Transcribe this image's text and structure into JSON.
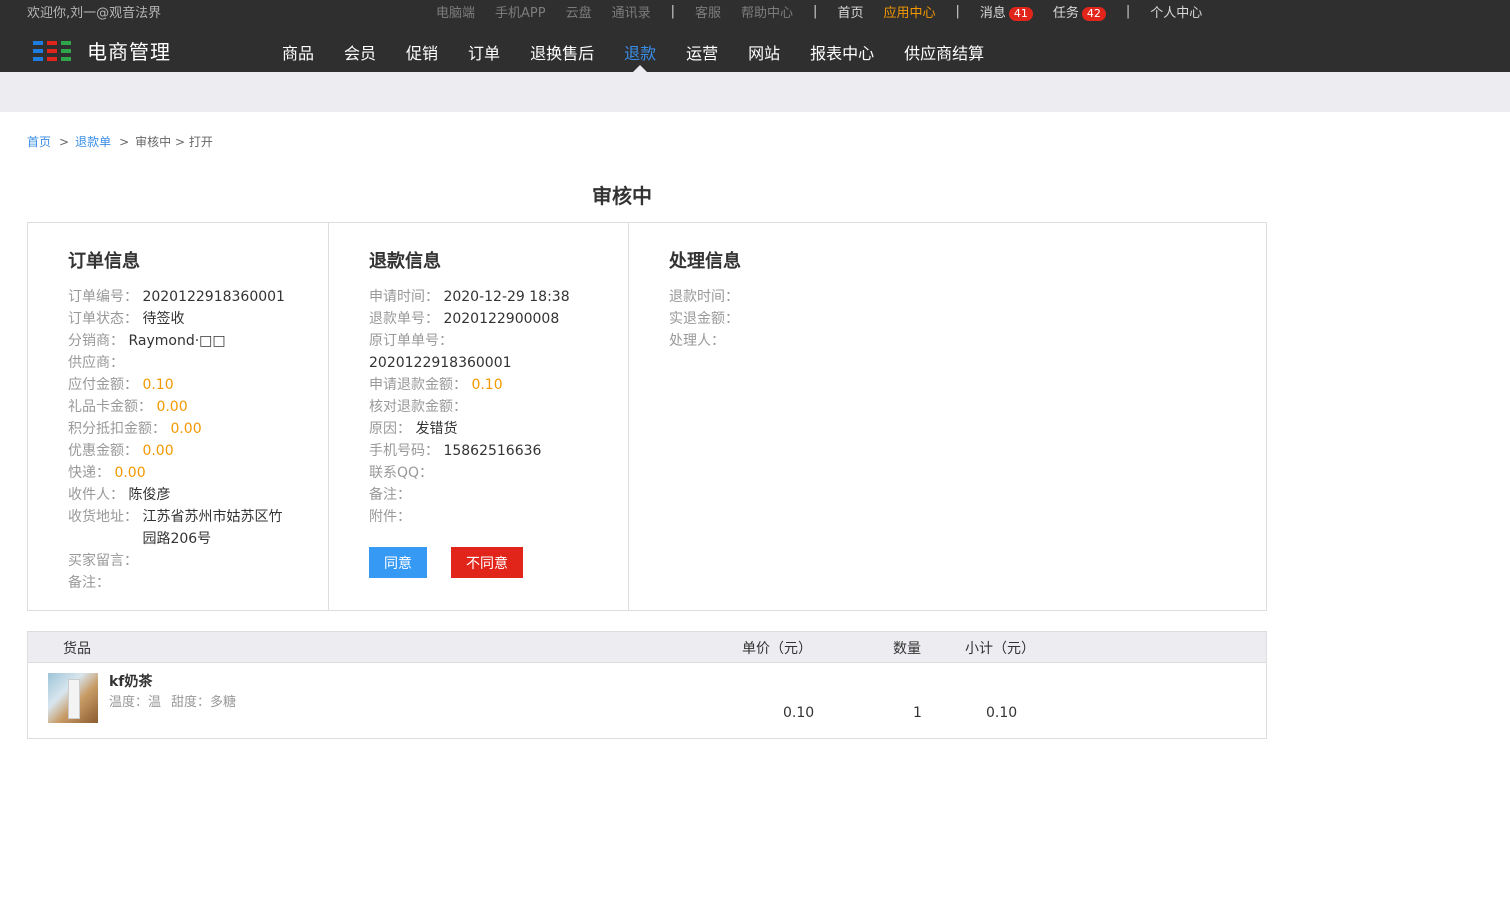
{
  "top": {
    "welcome": "欢迎你,刘一@观音法界",
    "links": [
      "电脑端",
      "手机APP",
      "云盘",
      "通讯录"
    ],
    "links2": [
      "客服",
      "帮助中心"
    ],
    "home": "首页",
    "app_center": "应用中心",
    "messages": "消息",
    "messages_count": "41",
    "tasks": "任务",
    "tasks_count": "42",
    "personal": "个人中心",
    "separator": "|"
  },
  "logo": {
    "text": "电商管理",
    "colors": [
      "#1f7de0",
      "#e1251b",
      "#2fa64a"
    ]
  },
  "nav": [
    "商品",
    "会员",
    "促销",
    "订单",
    "退换售后",
    "退款",
    "运营",
    "网站",
    "报表中心",
    "供应商结算"
  ],
  "nav_active": "退款",
  "breadcrumb": {
    "home": "首页",
    "refund_list": "退款单",
    "rest": "审核中 > 打开",
    "gt": ">"
  },
  "status_title": "审核中",
  "order_info": {
    "title": "订单信息",
    "order_no": {
      "label": "订单编号：",
      "value": "2020122918360001"
    },
    "order_status": {
      "label": "订单状态：",
      "value": "待签收"
    },
    "distributor": {
      "label": "分销商：",
      "value": "Raymond·□□"
    },
    "supplier": {
      "label": "供应商：",
      "value": ""
    },
    "payable": {
      "label": "应付金额：",
      "value": "0.10"
    },
    "gift_card": {
      "label": "礼品卡金额：",
      "value": "0.00"
    },
    "points": {
      "label": "积分抵扣金额：",
      "value": "0.00"
    },
    "discount": {
      "label": "优惠金额：",
      "value": "0.00"
    },
    "shipping": {
      "label": "快递：",
      "value": "0.00"
    },
    "receiver": {
      "label": "收件人：",
      "value": "陈俊彦"
    },
    "address": {
      "label": "收货地址：",
      "value": "江苏省苏州市姑苏区竹园路206号"
    },
    "buyer_msg": {
      "label": "买家留言：",
      "value": ""
    },
    "remark": {
      "label": "备注：",
      "value": ""
    }
  },
  "refund_info": {
    "title": "退款信息",
    "apply_time": {
      "label": "申请时间：",
      "value": "2020-12-29 18:38"
    },
    "refund_no": {
      "label": "退款单号：",
      "value": "2020122900008"
    },
    "orig_order_no": {
      "label": "原订单单号：",
      "value": "2020122918360001"
    },
    "apply_amount": {
      "label": "申请退款金额：",
      "value": "0.10"
    },
    "check_amount": {
      "label": "核对退款金额：",
      "value": ""
    },
    "reason": {
      "label": "原因：",
      "value": "发错货"
    },
    "phone": {
      "label": "手机号码：",
      "value": "15862516636"
    },
    "qq": {
      "label": "联系QQ：",
      "value": ""
    },
    "remark": {
      "label": "备注：",
      "value": ""
    },
    "attachment": {
      "label": "附件：",
      "value": ""
    },
    "agree_label": "同意",
    "disagree_label": "不同意"
  },
  "process_info": {
    "title": "处理信息",
    "refund_time": {
      "label": "退款时间：",
      "value": ""
    },
    "actual_amount": {
      "label": "实退金额：",
      "value": ""
    },
    "handler": {
      "label": "处理人：",
      "value": ""
    }
  },
  "goods": {
    "headers": {
      "item": "货品",
      "price": "单价（元）",
      "qty": "数量",
      "subtotal": "小计（元）"
    },
    "rows": [
      {
        "name": "kf奶茶",
        "spec1": "温度：温",
        "spec2": "甜度：多糖",
        "price": "0.10",
        "qty": "1",
        "subtotal": "0.10"
      }
    ]
  }
}
